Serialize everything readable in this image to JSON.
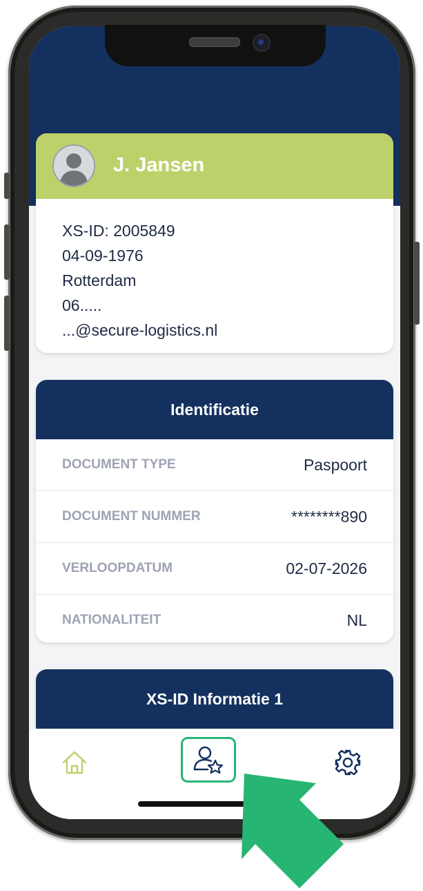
{
  "profile": {
    "name": "J. Jansen",
    "lines": [
      "XS-ID: 2005849",
      "04-09-1976",
      "Rotterdam",
      "06.....",
      "...@secure-logistics.nl"
    ]
  },
  "identification": {
    "title": "Identificatie",
    "rows": [
      {
        "label": "DOCUMENT TYPE",
        "value": "Paspoort"
      },
      {
        "label": "DOCUMENT NUMMER",
        "value": "********890"
      },
      {
        "label": "VERLOOPDATUM",
        "value": "02-07-2026"
      },
      {
        "label": "NATIONALITEIT",
        "value": "NL"
      }
    ]
  },
  "xs_info": {
    "title": "XS-ID Informatie 1"
  },
  "tabbar": {
    "items": [
      {
        "name": "home",
        "icon": "home-icon",
        "active": false
      },
      {
        "name": "profile",
        "icon": "user-star-icon",
        "active": true
      },
      {
        "name": "settings",
        "icon": "gear-icon",
        "active": false
      }
    ]
  },
  "colors": {
    "primary": "#14305e",
    "accent_green": "#bdd16b",
    "highlight": "#27b574",
    "label_gray": "#9ea3b3"
  }
}
